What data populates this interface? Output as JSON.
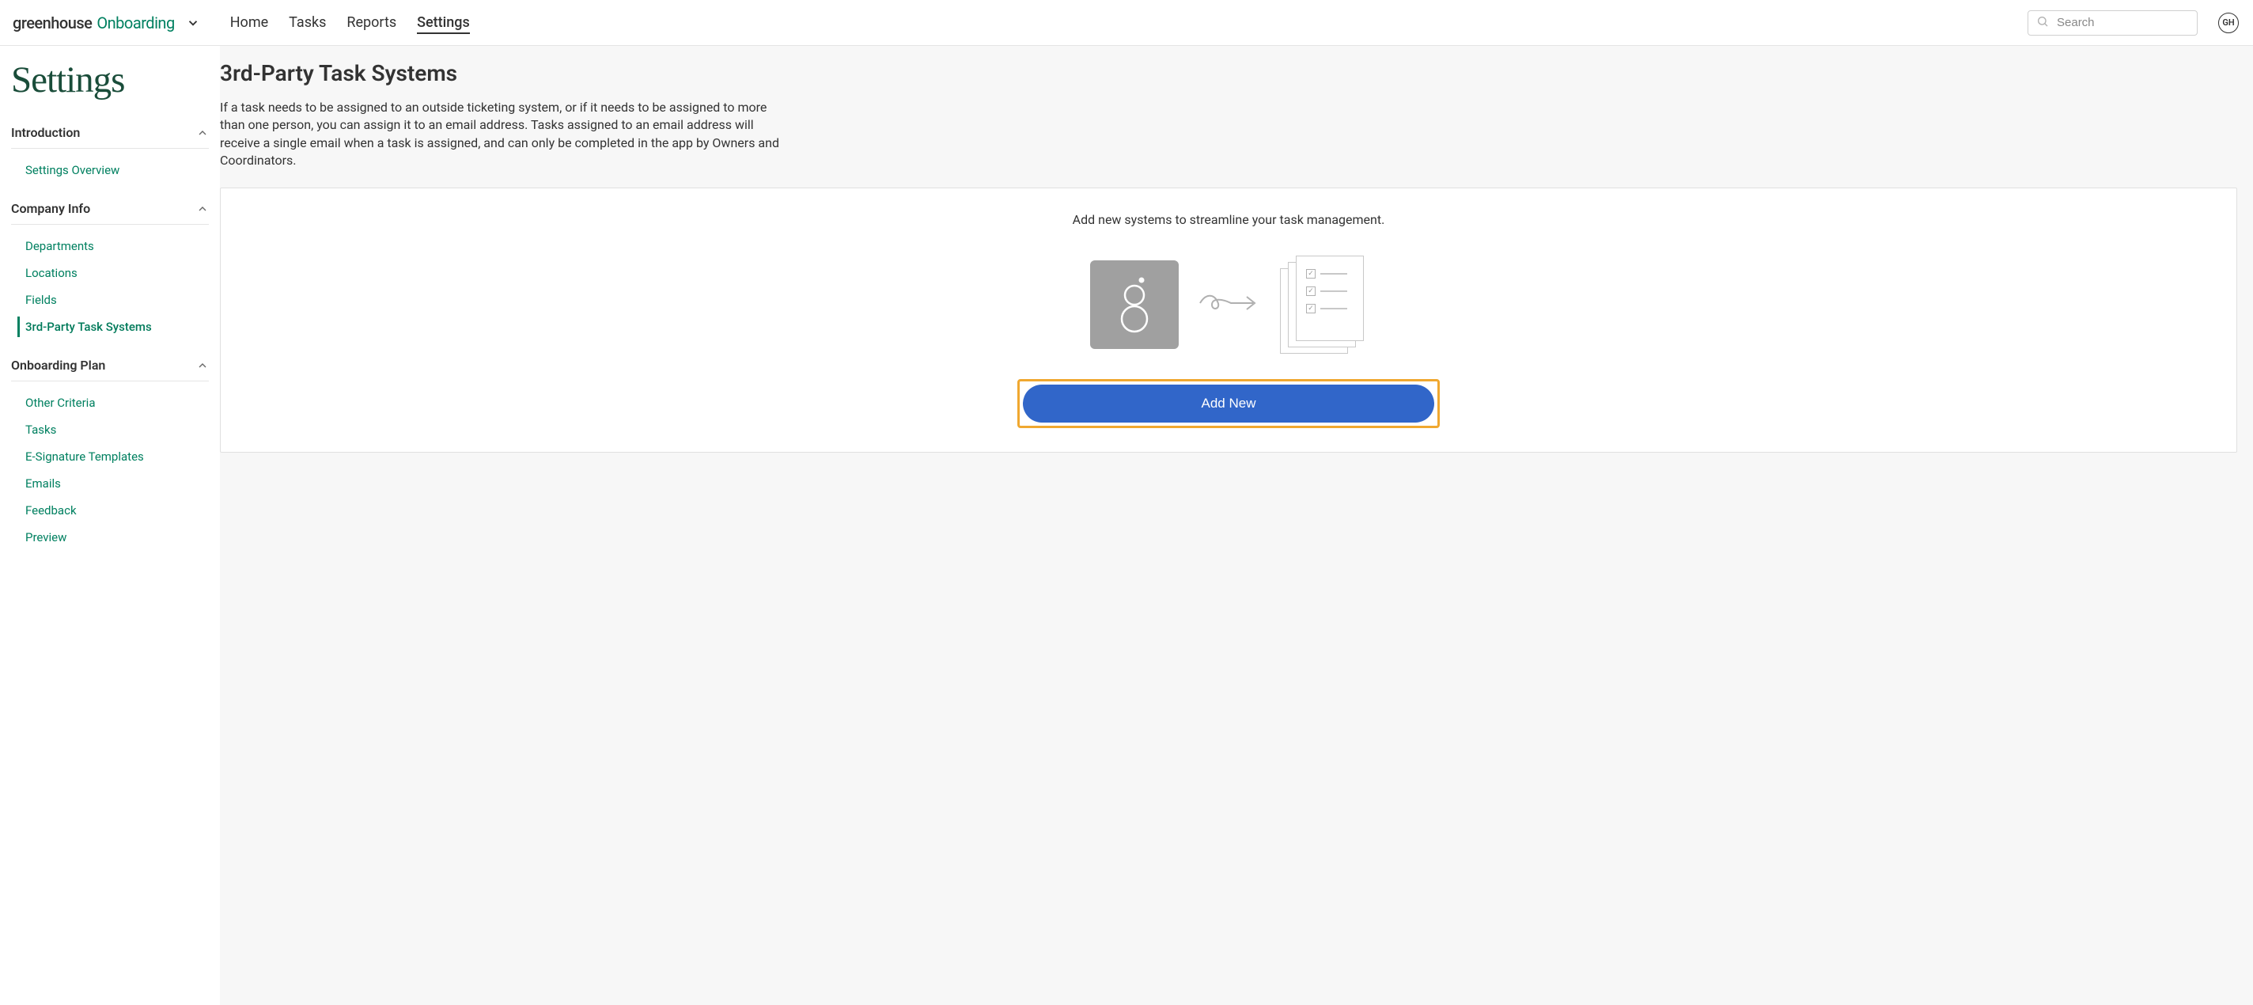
{
  "logo": {
    "part1": "greenhouse",
    "part2": "Onboarding"
  },
  "nav": {
    "home": "Home",
    "tasks": "Tasks",
    "reports": "Reports",
    "settings": "Settings"
  },
  "search": {
    "placeholder": "Search"
  },
  "avatar_initials": "GH",
  "page_title": "Settings",
  "sidebar": {
    "introduction": {
      "title": "Introduction",
      "items": {
        "overview": "Settings Overview"
      }
    },
    "company_info": {
      "title": "Company Info",
      "items": {
        "departments": "Departments",
        "locations": "Locations",
        "fields": "Fields",
        "third_party": "3rd-Party Task Systems"
      }
    },
    "onboarding_plan": {
      "title": "Onboarding Plan",
      "items": {
        "other_criteria": "Other Criteria",
        "tasks": "Tasks",
        "esignature": "E-Signature Templates",
        "emails": "Emails",
        "feedback": "Feedback",
        "preview": "Preview"
      }
    }
  },
  "main": {
    "heading": "3rd-Party Task Systems",
    "description": "If a task needs to be assigned to an outside ticketing system, or if it needs to be assigned to more than one person, you can assign it to an email address. Tasks assigned to an email address will receive a single email when a task is assigned, and can only be completed in the app by Owners and Coordinators.",
    "card_text": "Add new systems to streamline your task management.",
    "add_button": "Add New"
  }
}
